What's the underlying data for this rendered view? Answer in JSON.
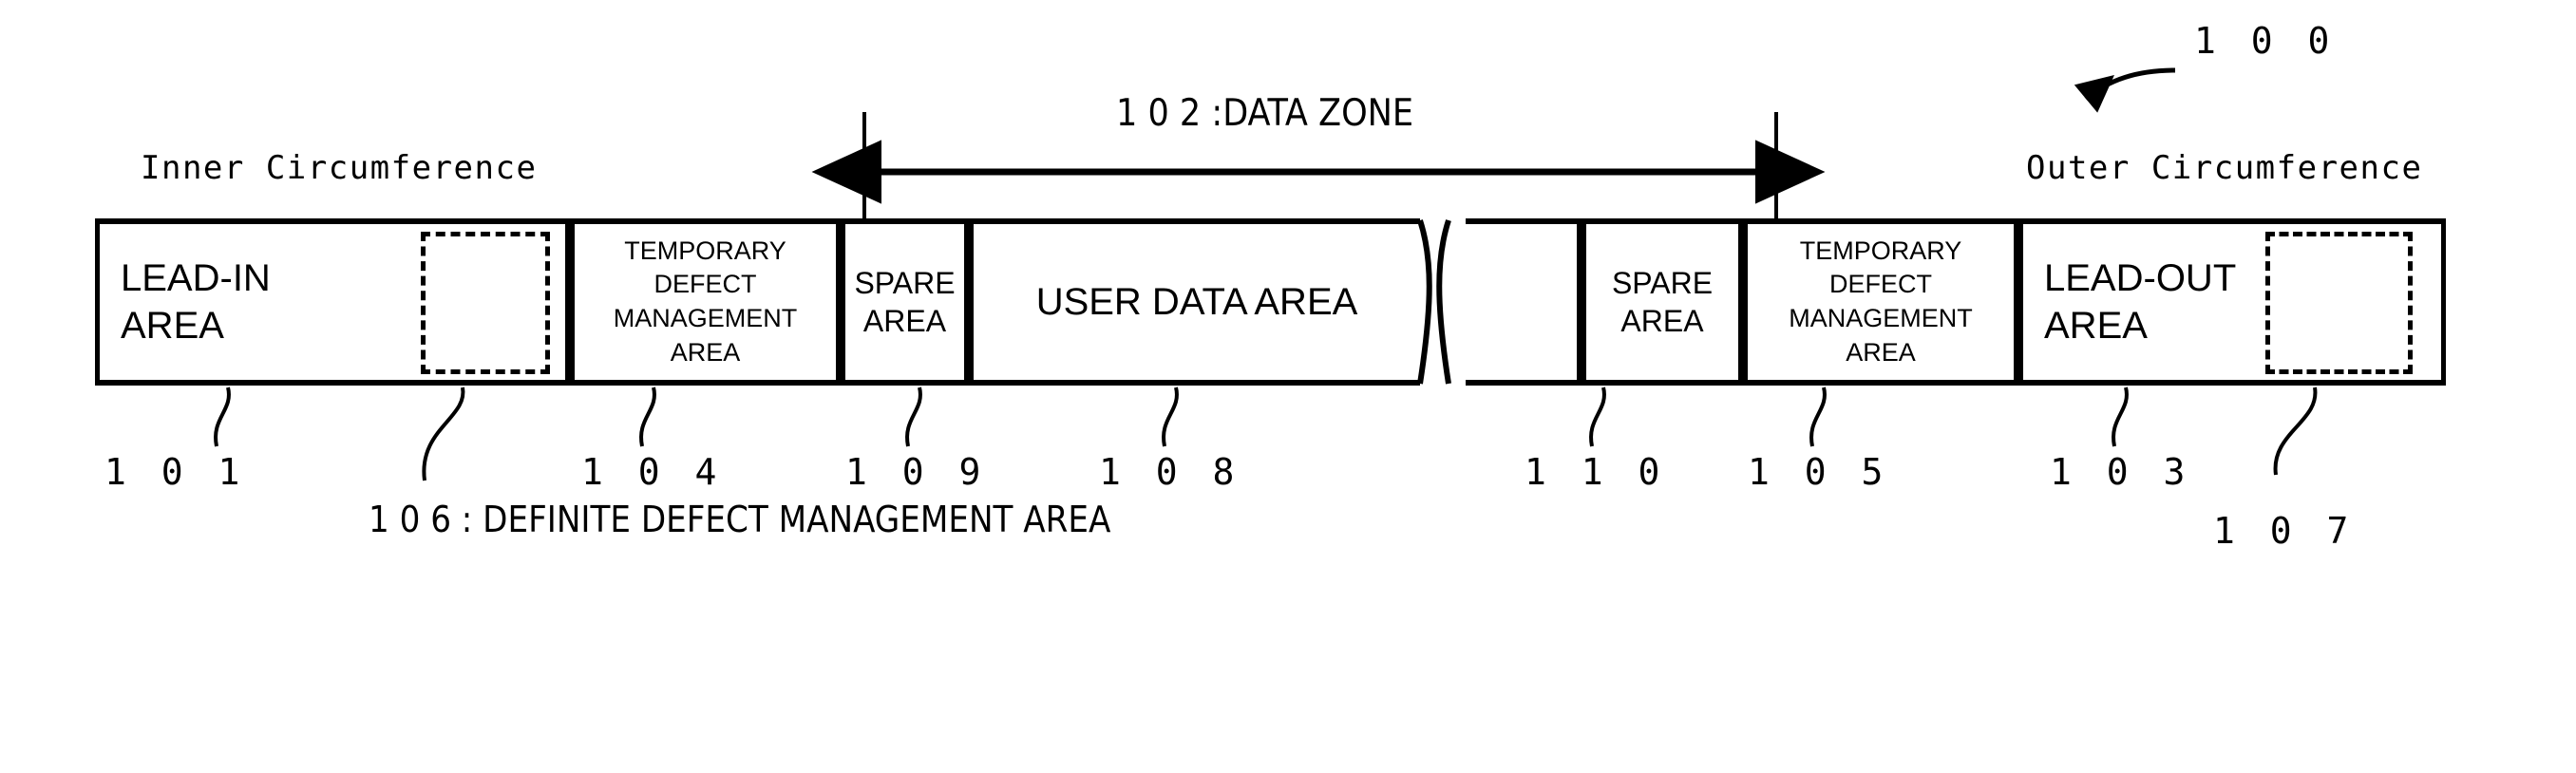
{
  "figure": {
    "ref_main": "1 0 0",
    "inner_label": "Inner Circumference",
    "outer_label": "Outer Circumference",
    "zone_label": "1 0 2 :DATA ZONE",
    "caption_106": "1 0 6 : DEFINITE DEFECT MANAGEMENT AREA"
  },
  "segments": [
    {
      "id": "lead-in",
      "label": "LEAD-IN\nAREA",
      "ref": "1 0 1"
    },
    {
      "id": "temp-defect-in",
      "label": "TEMPORARY\nDEFECT\nMANAGEMENT\nAREA",
      "ref": "1 0 4"
    },
    {
      "id": "spare-in",
      "label": "SPARE\nAREA",
      "ref": "1 0 9"
    },
    {
      "id": "user-data",
      "label": "USER DATA AREA",
      "ref": "1 0 8"
    },
    {
      "id": "user-data-cont",
      "label": "",
      "ref": ""
    },
    {
      "id": "spare-out",
      "label": "SPARE\nAREA",
      "ref": "1 1 0"
    },
    {
      "id": "temp-defect-out",
      "label": "TEMPORARY\nDEFECT\nMANAGEMENT\nAREA",
      "ref": "1 0 5"
    },
    {
      "id": "lead-out",
      "label": "LEAD-OUT\nAREA",
      "ref": "1 0 3"
    }
  ],
  "labels": {
    "lead_in_line1": "LEAD-IN",
    "lead_in_line2": "AREA",
    "lead_out_line1": "LEAD-OUT",
    "lead_out_line2": "AREA",
    "temp_l1": "TEMPORARY",
    "temp_l2": "DEFECT",
    "temp_l3": "MANAGEMENT",
    "temp_l4": "AREA",
    "spare_l1": "SPARE",
    "spare_l2": "AREA",
    "user_data": "USER DATA AREA"
  },
  "refs": {
    "r101": "1 0 1",
    "r104": "1 0 4",
    "r109": "1 0 9",
    "r108": "1 0 8",
    "r110": "1 1 0",
    "r105": "1 0 5",
    "r103": "1 0 3",
    "r107": "1 0 7",
    "r100": "1 0 0"
  },
  "dashed_regions": [
    {
      "id": "definite-defect-mgmt-inner",
      "ref": "1 0 6"
    },
    {
      "id": "definite-defect-mgmt-outer",
      "ref": "1 0 7"
    }
  ],
  "colors": {
    "ink": "#000000",
    "paper": "#ffffff"
  }
}
